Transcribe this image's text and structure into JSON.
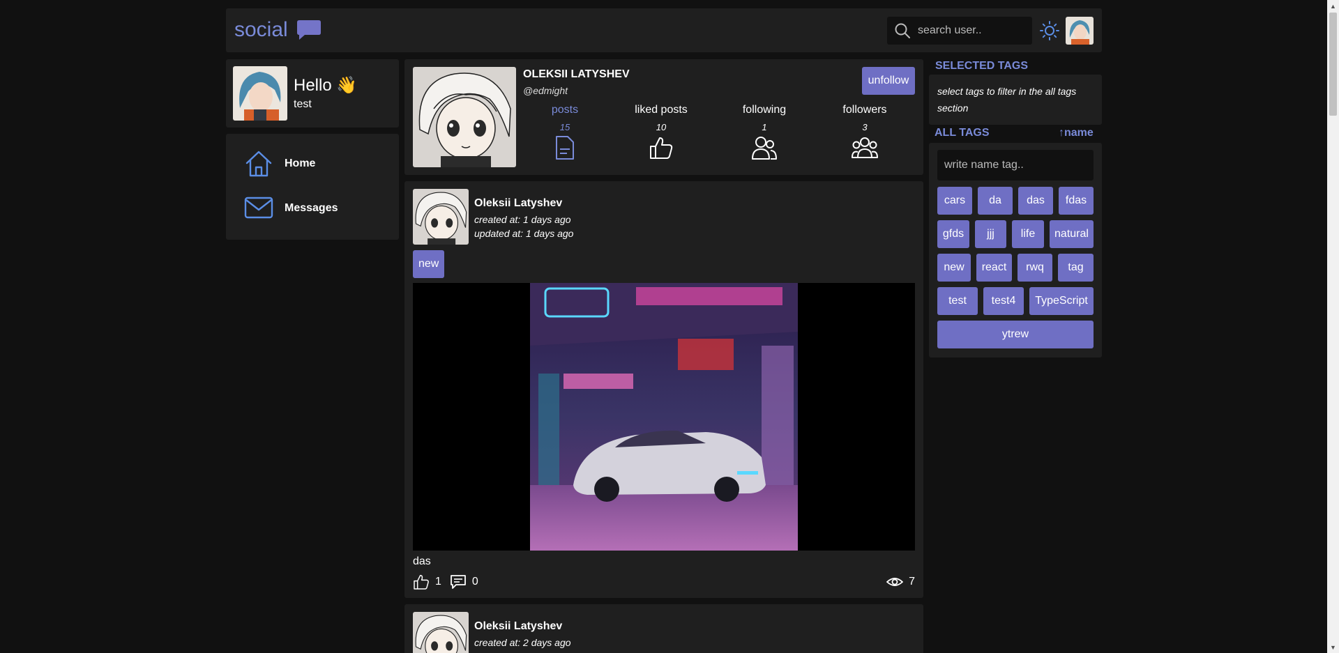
{
  "header": {
    "logo_text": "social",
    "search_placeholder": "search user.."
  },
  "greeting": {
    "title": "Hello 👋",
    "username": "test"
  },
  "nav": {
    "items": [
      {
        "label": "Home",
        "icon": "home-icon"
      },
      {
        "label": "Messages",
        "icon": "mail-icon"
      }
    ]
  },
  "profile": {
    "name": "OLEKSII LATYSHEV",
    "handle": "@edmight",
    "unfollow_label": "unfollow",
    "stats": [
      {
        "label": "posts",
        "count": "15",
        "icon": "document-icon"
      },
      {
        "label": "liked posts",
        "count": "10",
        "icon": "thumbs-up-icon"
      },
      {
        "label": "following",
        "count": "1",
        "icon": "users-icon"
      },
      {
        "label": "followers",
        "count": "3",
        "icon": "group-icon"
      }
    ]
  },
  "posts": [
    {
      "author": "Oleksii Latyshev",
      "created": "created at: 1 days ago",
      "updated": "updated at: 1 days ago",
      "tag": "new",
      "text": "das",
      "likes": "1",
      "comments": "0",
      "views": "7"
    },
    {
      "author": "Oleksii Latyshev",
      "created": "created at: 2 days ago"
    }
  ],
  "sidebar": {
    "selected_title": "SELECTED TAGS",
    "selected_hint": "select tags to filter in the all tags section",
    "all_title": "ALL TAGS",
    "sort_label": "↑name",
    "tag_placeholder": "write name tag..",
    "tags": [
      "cars",
      "da",
      "das",
      "fdas",
      "gfds",
      "jjj",
      "life",
      "natural",
      "new",
      "react",
      "rwq",
      "tag",
      "test",
      "test4",
      "TypeScript",
      "ytrew"
    ]
  },
  "colors": {
    "accent": "#7a8bd9",
    "button": "#6f6fc4",
    "card": "#1f1f1f",
    "background": "#111111"
  }
}
